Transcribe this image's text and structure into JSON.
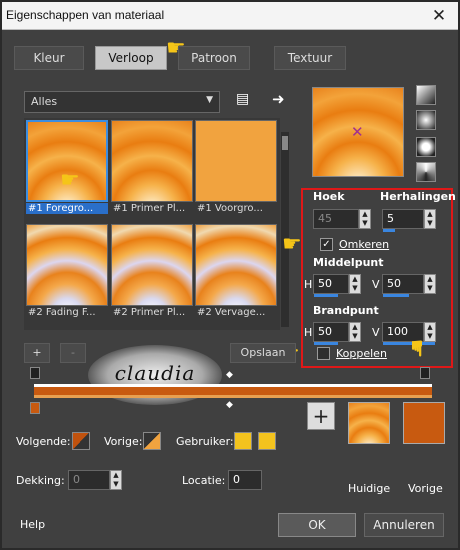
{
  "window": {
    "title": "Eigenschappen van materiaal",
    "close": "✕"
  },
  "tabs": [
    {
      "label": "Kleur"
    },
    {
      "label": "Verloop"
    },
    {
      "label": "Patroon"
    },
    {
      "label": "Textuur"
    }
  ],
  "category": {
    "value": "Alles"
  },
  "thumbnails": [
    {
      "label": "#1 Foregro..."
    },
    {
      "label": "#1 Primer Pl..."
    },
    {
      "label": "#1 Voorgro..."
    },
    {
      "label": "#2 Fading F..."
    },
    {
      "label": "#2 Primer Pl..."
    },
    {
      "label": "#2 Vervage..."
    }
  ],
  "settings": {
    "angle_label": "Hoek",
    "angle_value": "45",
    "repeats_label": "Herhalingen",
    "repeats_value": "5",
    "invert_label": "Omkeren",
    "invert_checked": true,
    "center_label": "Middelpunt",
    "center_h": "50",
    "center_v": "50",
    "focal_label": "Brandpunt",
    "focal_h": "50",
    "focal_v": "100",
    "link_label": "Koppelen",
    "link_checked": false,
    "h": "H",
    "v": "V"
  },
  "editor": {
    "add": "+",
    "remove": "-",
    "save": "Opslaan"
  },
  "watermark": {
    "text": "claudia"
  },
  "colors": {
    "follow_label": "Volgende:",
    "prev_label": "Vorige:",
    "user_label": "Gebruiker:",
    "opacity_label": "Dekking:",
    "opacity_value": "0",
    "location_label": "Locatie:",
    "location_value": "0",
    "follow_color": "#c0520e",
    "prev_color": "#f1a33f",
    "user_color": "#f3c31e",
    "add": "+",
    "current_label": "Huidige",
    "previous_label": "Vorige",
    "previous_swatch": "#c85a10"
  },
  "footer": {
    "help": "Help",
    "ok": "OK",
    "cancel": "Annuleren"
  }
}
